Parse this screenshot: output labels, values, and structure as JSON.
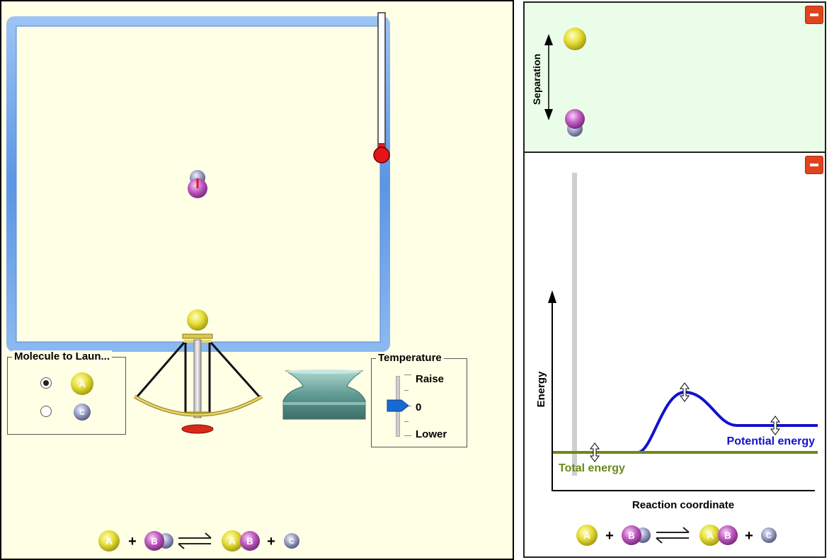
{
  "launcher_panel": {
    "title": "Molecule to Laun...",
    "options": [
      {
        "label": "A",
        "selected": true,
        "color": "#d6cf27"
      },
      {
        "label": "C",
        "selected": false,
        "color": "#8c91b5"
      }
    ]
  },
  "temperature": {
    "title": "Temperature",
    "raise_label": "Raise",
    "value_label": "0",
    "lower_label": "Lower",
    "slider_value": 0
  },
  "equation": {
    "reactant_a": "A",
    "reactant_bc_b": "B",
    "reactant_bc_c": "C",
    "product_ab_a": "A",
    "product_ab_b": "B",
    "product_c": "C",
    "plus": "+"
  },
  "separation_view": {
    "axis_label": "Separation"
  },
  "energy_view": {
    "y_label": "Energy",
    "x_label": "Reaction coordinate",
    "total_energy_label": "Total energy",
    "potential_energy_label": "Potential energy"
  },
  "colors": {
    "atom_a": "#d6cf27",
    "atom_b": "#b04db4",
    "atom_c": "#8c91b5",
    "total_energy": "#6b8a16",
    "potential_energy": "#1111cc",
    "box_frame": "#6fa3e8",
    "minimize_button": "#e2431f"
  }
}
